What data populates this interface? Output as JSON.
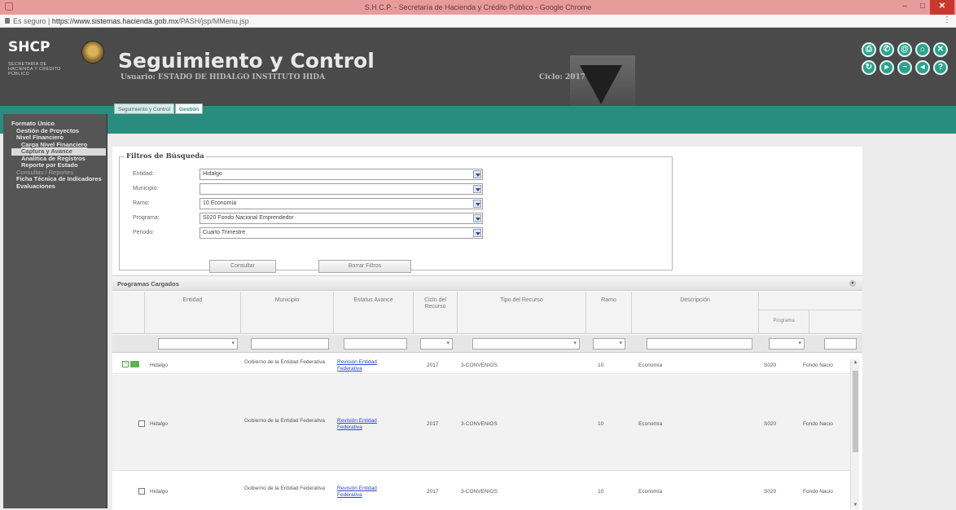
{
  "browser": {
    "window_title": "S.H.C.P. - Secretaría de Hacienda y Crédito Público - Google Chrome",
    "address_prefix": "Es seguro",
    "url_host": "https://www.sistemas.hacienda.gob.mx",
    "url_path": "/PASH/jsp/MMenu.jsp",
    "minimize_glyph": "–",
    "maximize_glyph": "□",
    "close_glyph": "✕",
    "menu_glyph": "⋮"
  },
  "header": {
    "logo_text": "SHCP",
    "logo_subtitle": "SECRETARÍA DE HACIENDA Y CRÉDITO PÚBLICO",
    "app_title": "Seguimiento y Control",
    "user_line": "Usuario: ESTADO DE HIDALGO INSTITUTO HIDA",
    "cycle": "Ciclo: 2017",
    "tool_icons": [
      {
        "name": "print-icon",
        "glyph": "⎙"
      },
      {
        "name": "phone-icon",
        "glyph": "✆"
      },
      {
        "name": "email-icon",
        "glyph": "@"
      },
      {
        "name": "home-icon",
        "glyph": "⌂"
      },
      {
        "name": "close-icon",
        "glyph": "✕"
      },
      {
        "name": "refresh-icon",
        "glyph": "↻"
      },
      {
        "name": "forward-icon",
        "glyph": "▸"
      },
      {
        "name": "minus-icon",
        "glyph": "−"
      },
      {
        "name": "back-icon",
        "glyph": "◂"
      },
      {
        "name": "help-icon",
        "glyph": "?"
      }
    ]
  },
  "tabs": [
    {
      "label": "Seguimiento y Control"
    },
    {
      "label": "Gestión"
    }
  ],
  "sidebar": {
    "items": [
      {
        "label": "Formato Único",
        "level": 0,
        "style": "normal"
      },
      {
        "label": "Gestión de Proyectos",
        "level": 1,
        "style": "normal"
      },
      {
        "label": "Nivel Financiero",
        "level": 1,
        "style": "normal"
      },
      {
        "label": "Carga Nivel Financiero",
        "level": 2,
        "style": "underline"
      },
      {
        "label": "Captura y Avance",
        "level": 2,
        "style": "selected"
      },
      {
        "label": "Analítica de Registros",
        "level": 2,
        "style": "normal"
      },
      {
        "label": "Reporte por Estado",
        "level": 2,
        "style": "normal"
      },
      {
        "label": "Consultas / Reportes",
        "level": 1,
        "style": "dim"
      },
      {
        "label": "Ficha Técnica de Indicadores",
        "level": 1,
        "style": "normal"
      },
      {
        "label": "Evaluaciones",
        "level": 1,
        "style": "normal"
      }
    ]
  },
  "filters": {
    "legend": "Filtros de Búsqueda",
    "fields": [
      {
        "label": "Entidad:",
        "value": "Hidalgo"
      },
      {
        "label": "Municipio:",
        "value": ""
      },
      {
        "label": "Ramo:",
        "value": "10 Economía"
      },
      {
        "label": "Programa:",
        "value": "S020 Fondo Nacional Emprendedor"
      },
      {
        "label": "Periodo:",
        "value": "Cuarto Trimestre"
      }
    ],
    "consult_label": "Consultar",
    "clear_label": "Borrar Filtros"
  },
  "grid": {
    "caption": "Programas Cargados",
    "collapse_glyph": "▾",
    "columns": [
      "Entidad",
      "Municipio",
      "Estatus Avance",
      "Ciclo del Recurso",
      "Tipo del Recurso",
      "Ramo",
      "Descripción",
      "Programa",
      ""
    ],
    "program_subheader": "Programa",
    "rows": [
      {
        "entidad": "Hidalgo",
        "municipio": "Gobierno de la Entidad Federativa",
        "estatus": "Revisión Entidad Federativa",
        "ciclo": "2017",
        "tipo": "3-CONVENIOS",
        "ramo": "10",
        "descripcion": "Economía",
        "programa": "S020",
        "fondo": "Fondo Nacio"
      },
      {
        "entidad": "Hidalgo",
        "municipio": "Gobierno de la Entidad Federativa",
        "estatus": "Revisión Entidad Federativa",
        "ciclo": "2017",
        "tipo": "3-CONVENIOS",
        "ramo": "10",
        "descripcion": "Economía",
        "programa": "S020",
        "fondo": "Fondo Nacio"
      },
      {
        "entidad": "Hidalgo",
        "municipio": "Gobierno de la Entidad Federativa",
        "estatus": "Revisión Entidad Federativa",
        "ciclo": "2017",
        "tipo": "3-CONVENIOS",
        "ramo": "10",
        "descripcion": "Economía",
        "programa": "S020",
        "fondo": "Fondo Nacio"
      }
    ]
  },
  "colors": {
    "teal": "#2a8c7e",
    "header_gray": "#4a4a4a",
    "sidebar_gray": "#555555",
    "chrome_red": "#e89b9b"
  }
}
